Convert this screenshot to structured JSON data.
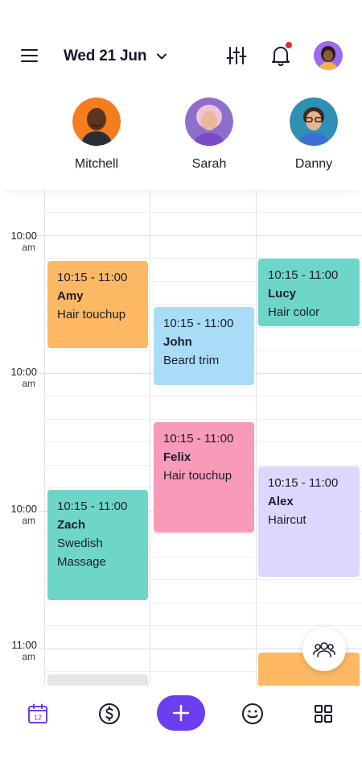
{
  "header": {
    "date_label": "Wed 21 Jun",
    "icons": [
      "menu-icon",
      "chevron-down-icon",
      "filter-sliders-icon",
      "bell-icon",
      "avatar"
    ]
  },
  "staff": [
    {
      "name": "Mitchell",
      "color": "#f57c1f"
    },
    {
      "name": "Sarah",
      "color": "#8f6fc9"
    },
    {
      "name": "Danny",
      "color": "#2f8fb5"
    }
  ],
  "time_labels": [
    {
      "time": "10:00",
      "period": "am"
    },
    {
      "time": "10:00",
      "period": "am"
    },
    {
      "time": "10:00",
      "period": "am"
    },
    {
      "time": "11:00",
      "period": "am"
    }
  ],
  "appointments": [
    {
      "time": "10:15 - 11:00",
      "name": "Amy",
      "service": "Hair touchup",
      "color": "#fdb864"
    },
    {
      "time": "10:15 - 11:00",
      "name": "John",
      "service": "Beard trim",
      "color": "#a9ddf7"
    },
    {
      "time": "10:15 - 11:00",
      "name": "Lucy",
      "service": "Hair color",
      "color": "#6dd6c8"
    },
    {
      "time": "10:15 - 11:00",
      "name": "Felix",
      "service": "Hair touchup",
      "color": "#f99ab9"
    },
    {
      "time": "10:15 - 11:00",
      "name": "Alex",
      "service": "Haircut",
      "color": "#dcd8fd"
    },
    {
      "time": "10:15 - 11:00",
      "name": "Zach",
      "service": "Swedish Massage",
      "color": "#6dd6c8"
    }
  ],
  "bottom_nav": {
    "calendar_day": "12",
    "items": [
      "calendar-icon",
      "dollar-icon",
      "add-icon",
      "smiley-icon",
      "grid-icon"
    ]
  },
  "colors": {
    "accent": "#6b3ef0",
    "notification": "#e8253d"
  }
}
